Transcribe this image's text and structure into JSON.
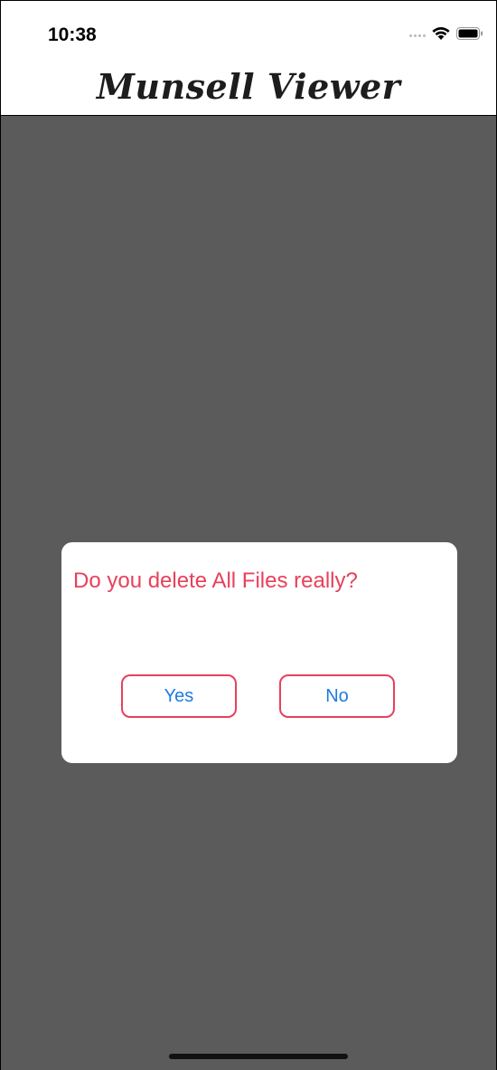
{
  "status_bar": {
    "time": "10:38",
    "icons": [
      "cellular-signal-icon",
      "wifi-icon",
      "battery-icon"
    ]
  },
  "nav_bar": {
    "title": "Munsell Viewer"
  },
  "dialog": {
    "message": "Do you delete All Files really?",
    "yes_label": "Yes",
    "no_label": "No"
  },
  "colors": {
    "content_background": "#5b5b5b",
    "dialog_text": "#e8405c",
    "button_border": "#e8405c",
    "button_text": "#1f7ae0"
  }
}
